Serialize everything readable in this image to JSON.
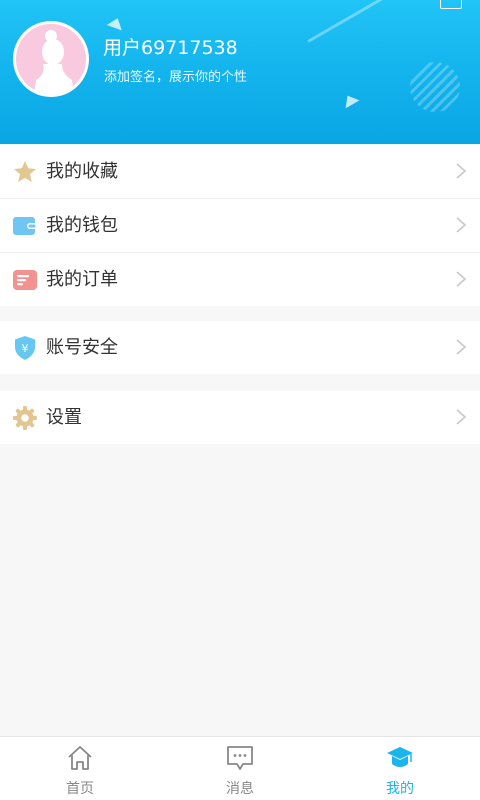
{
  "profile": {
    "username": "用户69717538",
    "signature": "添加签名，展示你的个性"
  },
  "menu_groups": [
    {
      "items": [
        {
          "label": "我的收藏",
          "icon": "star-icon"
        },
        {
          "label": "我的钱包",
          "icon": "wallet-icon"
        },
        {
          "label": "我的订单",
          "icon": "order-icon"
        }
      ]
    },
    {
      "items": [
        {
          "label": "账号安全",
          "icon": "shield-icon"
        }
      ]
    },
    {
      "items": [
        {
          "label": "设置",
          "icon": "gear-icon"
        }
      ]
    }
  ],
  "tabbar": {
    "tabs": [
      {
        "label": "首页",
        "icon": "home-icon",
        "active": false
      },
      {
        "label": "消息",
        "icon": "message-icon",
        "active": false
      },
      {
        "label": "我的",
        "icon": "graduation-cap-icon",
        "active": true
      }
    ]
  },
  "colors": {
    "header": "#12b2ec",
    "accent": "#1ab4ee",
    "star": "#e2c793",
    "wallet": "#6fc6f2",
    "order": "#f4928f",
    "shield": "#66c8f2",
    "gear": "#e3c58f"
  }
}
